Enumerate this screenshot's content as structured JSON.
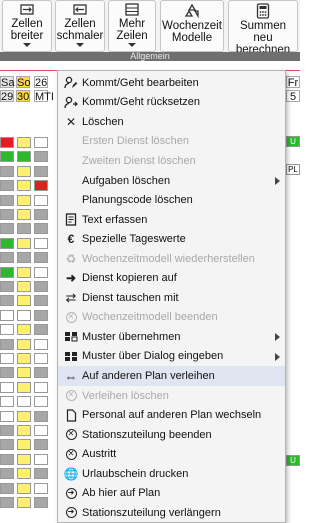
{
  "ribbon": {
    "buttons": [
      {
        "label": "Zellen\nbreiter",
        "icon": "widen-cells-icon",
        "has_dropdown": true
      },
      {
        "label": "Zellen\nschmaler",
        "icon": "narrow-cells-icon",
        "has_dropdown": true
      },
      {
        "label": "Mehr\nZeilen",
        "icon": "more-rows-icon",
        "has_dropdown": true
      },
      {
        "label": "Wochenzeit\nModelle",
        "icon": "recycle-icon",
        "has_dropdown": false
      },
      {
        "label": "Summen neu\nberechnen",
        "icon": "calculator-icon",
        "has_dropdown": false
      }
    ],
    "group_label": "Allgemein"
  },
  "grid": {
    "day_headers": [
      {
        "day": "Sa",
        "date": "29",
        "color": "#e8e8e8"
      },
      {
        "day": "So",
        "date": "30",
        "color": "#ffd84a"
      },
      {
        "day": "26",
        "date": "MTI",
        "color": "#ffffff"
      }
    ],
    "right_header": {
      "day": "Fr",
      "date": "5"
    },
    "right_badges": [
      "U",
      "PL",
      "U"
    ]
  },
  "context_menu": {
    "items": [
      {
        "label": "Kommt/Geht bearbeiten",
        "icon": "user-edit-icon",
        "enabled": true,
        "submenu": false
      },
      {
        "label": "Kommt/Geht rücksetzen",
        "icon": "user-reset-icon",
        "enabled": true,
        "submenu": false
      },
      {
        "label": "Löschen",
        "icon": "delete-x-icon",
        "enabled": true,
        "submenu": false
      },
      {
        "label": "Ersten Dienst löschen",
        "icon": "",
        "enabled": false,
        "submenu": false
      },
      {
        "label": "Zweiten Dienst löschen",
        "icon": "",
        "enabled": false,
        "submenu": false
      },
      {
        "label": "Aufgaben löschen",
        "icon": "",
        "enabled": true,
        "submenu": true
      },
      {
        "label": "Planungscode löschen",
        "icon": "",
        "enabled": true,
        "submenu": false
      },
      {
        "label": "Text erfassen",
        "icon": "text-doc-icon",
        "enabled": true,
        "submenu": false
      },
      {
        "label": "Spezielle Tageswerte",
        "icon": "euro-icon",
        "enabled": true,
        "submenu": false
      },
      {
        "label": "Wochenzeitmodell wiederherstellen",
        "icon": "recycle-icon",
        "enabled": false,
        "submenu": false
      },
      {
        "label": "Dienst kopieren auf",
        "icon": "arrow-right-icon",
        "enabled": true,
        "submenu": false
      },
      {
        "label": "Dienst tauschen mit",
        "icon": "swap-icon",
        "enabled": true,
        "submenu": false
      },
      {
        "label": "Wochenzeitmodell beenden",
        "icon": "circle-x-icon",
        "enabled": false,
        "submenu": false
      },
      {
        "label": "Muster übernehmen",
        "icon": "pattern-icon",
        "enabled": true,
        "submenu": true
      },
      {
        "label": "Muster über Dialog eingeben",
        "icon": "pattern-dialog-icon",
        "enabled": true,
        "submenu": true
      },
      {
        "label": "Auf anderen Plan verleihen",
        "icon": "double-arrow-icon",
        "enabled": true,
        "submenu": false,
        "highlighted": true
      },
      {
        "label": "Verleihen löschen",
        "icon": "circle-x-icon",
        "enabled": false,
        "submenu": false
      },
      {
        "label": "Personal auf anderen Plan wechseln",
        "icon": "doc-icon",
        "enabled": true,
        "submenu": false
      },
      {
        "label": "Stationszuteilung beenden",
        "icon": "circle-x-icon",
        "enabled": true,
        "submenu": false
      },
      {
        "label": "Austritt",
        "icon": "circle-x-icon",
        "enabled": true,
        "submenu": false
      },
      {
        "label": "Urlaubschein drucken",
        "icon": "globe-icon",
        "enabled": true,
        "submenu": false
      },
      {
        "label": "Ab hier auf Plan",
        "icon": "circle-arrow-icon",
        "enabled": true,
        "submenu": false
      },
      {
        "label": "Stationszuteilung verlängern",
        "icon": "circle-arrow-icon",
        "enabled": true,
        "submenu": false
      }
    ]
  }
}
